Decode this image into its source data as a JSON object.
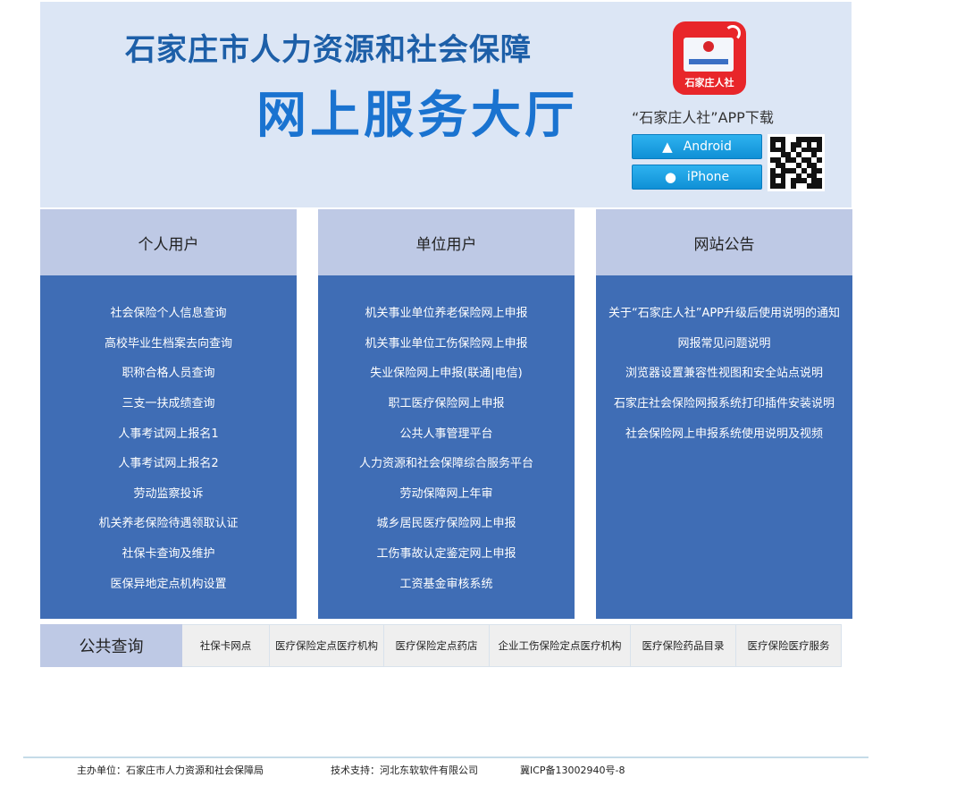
{
  "header": {
    "title_line1": "石家庄市人力资源和社会保障",
    "title_line2": "网上服务大厅",
    "app_logo_text": "石家庄人社",
    "app_download": "“石家庄人社”APP下载",
    "android_label": "Android",
    "iphone_label": "iPhone",
    "android_icon": "android-icon",
    "apple_icon": "apple-icon"
  },
  "panels": [
    {
      "title": "个人用户",
      "items": [
        "社会保险个人信息查询",
        "高校毕业生档案去向查询",
        "职称合格人员查询",
        "三支一扶成绩查询",
        "人事考试网上报名1",
        "人事考试网上报名2",
        "劳动监察投诉",
        "机关养老保险待遇领取认证",
        "社保卡查询及维护",
        "医保异地定点机构设置"
      ]
    },
    {
      "title": "单位用户",
      "items": [
        "机关事业单位养老保险网上申报",
        "机关事业单位工伤保险网上申报",
        "失业保险网上申报(联通|电信)",
        "职工医疗保险网上申报",
        "公共人事管理平台",
        "人力资源和社会保障综合服务平台",
        "劳动保障网上年审",
        "城乡居民医疗保险网上申报",
        "工伤事故认定鉴定网上申报",
        "工资基金审核系统"
      ]
    },
    {
      "title": "网站公告",
      "items": [
        "关于“石家庄人社”APP升级后使用说明的通知",
        "网报常见问题说明",
        "浏览器设置兼容性视图和安全站点说明",
        "石家庄社会保险网报系统打印插件安装说明",
        "社会保险网上申报系统使用说明及视频"
      ]
    }
  ],
  "public_query": {
    "label": "公共查询",
    "tabs": [
      "社保卡网点",
      "医疗保险定点医疗机构",
      "医疗保险定点药店",
      "企业工伤保险定点医疗机构",
      "医疗保险药品目录",
      "医疗保险医疗服务"
    ]
  },
  "footer": {
    "sponsor": "主办单位：石家庄市人力资源和社会保障局",
    "support": "技术支持：河北东软软件有限公司",
    "icp": "冀ICP备13002940号-8"
  },
  "colors": {
    "header_bg": "#dce6f5",
    "title_blue": "#1d5fa8",
    "panel_blue": "#3f6db5",
    "panel_head": "#bec9e5",
    "button_blue": "#1ba0e2",
    "logo_red": "#e8262a"
  }
}
